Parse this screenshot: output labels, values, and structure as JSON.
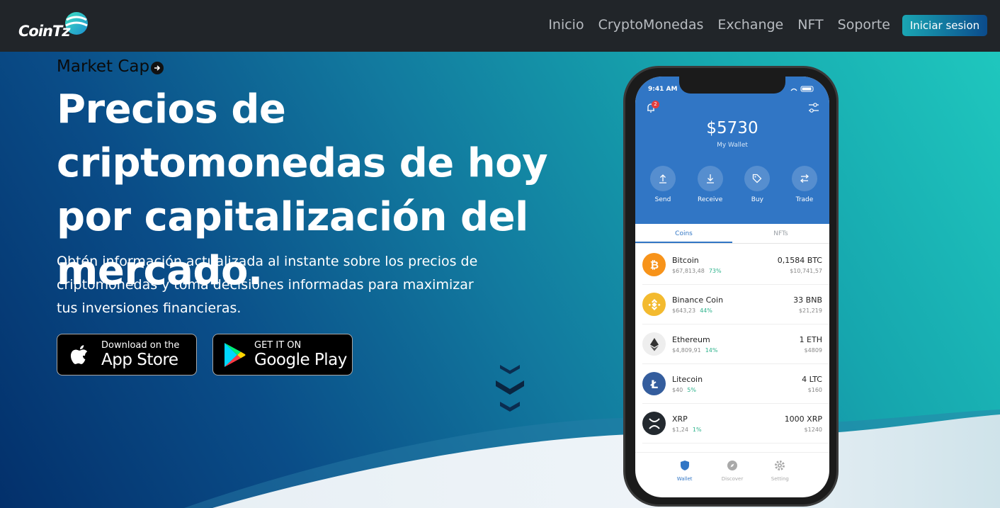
{
  "nav": {
    "logo": "CoinTz",
    "links": [
      "Inicio",
      "CryptoMonedas",
      "Exchange",
      "NFT",
      "Soporte"
    ],
    "login": "Iniciar sesion"
  },
  "hero": {
    "market_cap": "Market Cap",
    "title": "Precios de criptomonedas de hoy por capitalización del mercado.",
    "description": "Obtén información actualizada al instante sobre los precios de criptomonedas y toma decisiones informadas para maximizar tus inversiones financieras.",
    "appstore_small": "Download on the",
    "appstore_big": "App Store",
    "gplay_small": "GET IT ON",
    "gplay_big": "Google Play"
  },
  "phone": {
    "time": "9:41 AM",
    "notifications": "2",
    "balance": "$5730",
    "wallet_label": "My Wallet",
    "actions": [
      "Send",
      "Receive",
      "Buy",
      "Trade"
    ],
    "tabs": [
      "Coins",
      "NFTs"
    ],
    "coins": [
      {
        "name": "Bitcoin",
        "price": "$67,813,48",
        "pct": "73%",
        "amount": "0,1584 BTC",
        "usd": "$10,741,57",
        "icon": "bitcoin-icon",
        "color": "#f7931a"
      },
      {
        "name": "Binance Coin",
        "price": "$643,23",
        "pct": "44%",
        "amount": "33 BNB",
        "usd": "$21,219",
        "icon": "binance-icon",
        "color": "#f3ba2f"
      },
      {
        "name": "Ethereum",
        "price": "$4,809,91",
        "pct": "14%",
        "amount": "1 ETH",
        "usd": "$4809",
        "icon": "ethereum-icon",
        "color": "#eeeeee"
      },
      {
        "name": "Litecoin",
        "price": "$40",
        "pct": "5%",
        "amount": "4 LTC",
        "usd": "$160",
        "icon": "litecoin-icon",
        "color": "#345d9d"
      },
      {
        "name": "XRP",
        "price": "$1,24",
        "pct": "1%",
        "amount": "1000 XRP",
        "usd": "$1240",
        "icon": "xrp-icon",
        "color": "#23292f"
      }
    ],
    "bottom_nav": [
      "Wallet",
      "Discover",
      "Setting"
    ]
  },
  "colors": {
    "nav_bg": "#212529",
    "wallet_blue": "#3176c5",
    "positive": "#2db28c"
  }
}
